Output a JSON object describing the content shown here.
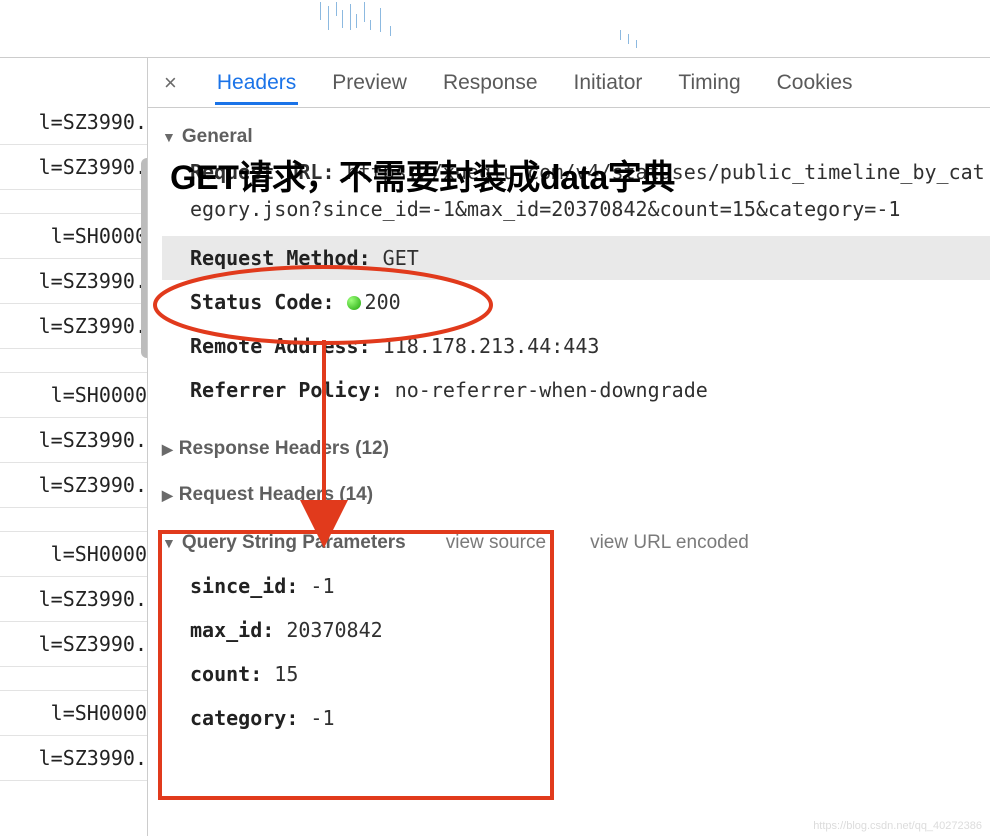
{
  "tabs": {
    "close": "×",
    "headers": "Headers",
    "preview": "Preview",
    "response": "Response",
    "initiator": "Initiator",
    "timing": "Timing",
    "cookies": "Cookies"
  },
  "left_items": [
    "l=SZ3990.",
    "l=SZ3990.",
    "",
    "l=SH0000",
    "l=SZ3990.",
    "l=SZ3990.",
    "",
    "l=SH0000",
    "l=SZ3990.",
    "l=SZ3990.",
    "",
    "l=SH0000",
    "l=SZ3990.",
    "l=SZ3990.",
    "",
    "l=SH0000",
    "l=SZ3990."
  ],
  "general": {
    "label": "General",
    "request_url_label": "Request URL:",
    "request_url_value": "https://xueqiu.com/v4/statuses/public_timeline_by_category.json?since_id=-1&max_id=20370842&count=15&category=-1",
    "request_method_label": "Request Method:",
    "request_method_value": "GET",
    "status_code_label": "Status Code:",
    "status_code_value": "200",
    "remote_address_label": "Remote Address:",
    "remote_address_value": "118.178.213.44:443",
    "referrer_policy_label": "Referrer Policy:",
    "referrer_policy_value": "no-referrer-when-downgrade"
  },
  "response_headers_label": "Response Headers (12)",
  "request_headers_label": "Request Headers (14)",
  "qs": {
    "label": "Query String Parameters",
    "view_source": "view source",
    "view_url_encoded": "view URL encoded",
    "params": [
      {
        "k": "since_id:",
        "v": "-1"
      },
      {
        "k": "max_id:",
        "v": "20370842"
      },
      {
        "k": "count:",
        "v": "15"
      },
      {
        "k": "category:",
        "v": "-1"
      }
    ]
  },
  "annotation_text": "GET请求，不需要封装成data字典",
  "watermark": "https://blog.csdn.net/qq_40272386"
}
